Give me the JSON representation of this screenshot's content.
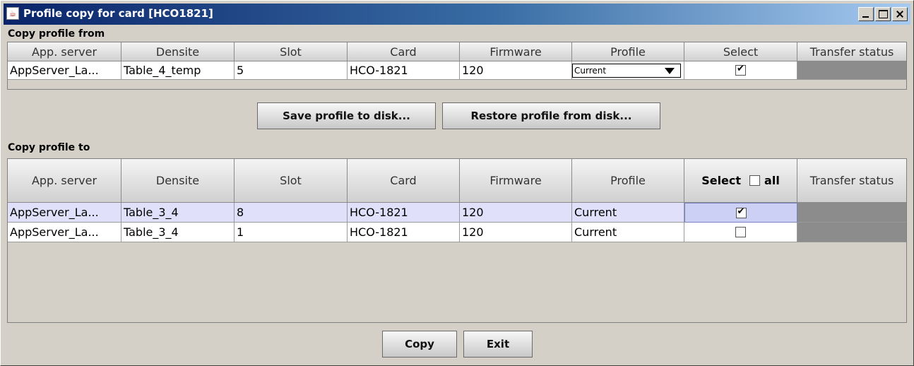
{
  "window": {
    "title": "Profile copy for card [HCO1821]"
  },
  "source": {
    "label": "Copy profile from",
    "columns": [
      "App. server",
      "Densite",
      "Slot",
      "Card",
      "Firmware",
      "Profile",
      "Select",
      "Transfer status"
    ],
    "row": {
      "app_server": "AppServer_La...",
      "densite": "Table_4_temp",
      "slot": "5",
      "card": "HCO-1821",
      "firmware": "120",
      "profile": "Current",
      "selected": true,
      "transfer_status": ""
    }
  },
  "actions": {
    "save_label": "Save profile to disk...",
    "restore_label": "Restore profile from disk..."
  },
  "target": {
    "label": "Copy profile to",
    "columns": [
      "App. server",
      "Densite",
      "Slot",
      "Card",
      "Firmware",
      "Profile",
      "Select",
      "Transfer status"
    ],
    "select_all_label": "all",
    "select_all_checked": false,
    "rows": [
      {
        "app_server": "AppServer_La...",
        "densite": "Table_3_4",
        "slot": "8",
        "card": "HCO-1821",
        "firmware": "120",
        "profile": "Current",
        "selected": true,
        "transfer_status": ""
      },
      {
        "app_server": "AppServer_La...",
        "densite": "Table_3_4",
        "slot": "1",
        "card": "HCO-1821",
        "firmware": "120",
        "profile": "Current",
        "selected": false,
        "transfer_status": ""
      }
    ]
  },
  "footer": {
    "copy_label": "Copy",
    "exit_label": "Exit"
  },
  "icons": {
    "app_icon": "java-cup-icon",
    "minimize": "minimize-icon",
    "maximize": "maximize-icon",
    "close": "close-icon"
  }
}
